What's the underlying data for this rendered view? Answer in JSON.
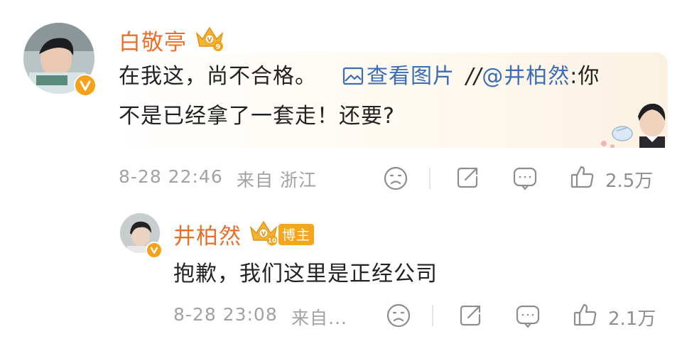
{
  "comment": {
    "username": "白敬亭",
    "text_part1": "在我这，尚不合格。",
    "image_link": "查看图片",
    "repost_prefix": "//",
    "mention": "@井柏然",
    "text_part2": ":你",
    "text_line2": "不是已经拿了一套走！还要?",
    "timestamp": "8-28 22:46",
    "source": "来自 浙江",
    "likes": "2.5万",
    "crown_level": "9"
  },
  "reply": {
    "username": "井柏然",
    "crown_level": "10",
    "badge": "博主",
    "text": "抱歉，我们这里是正经公司",
    "timestamp": "8-28 23:08",
    "source": "来自...",
    "likes": "2.1万"
  },
  "colors": {
    "username": "#e8702a",
    "link": "#3a6db3",
    "meta": "#a2a2a2",
    "badge": "#f6a61e"
  }
}
